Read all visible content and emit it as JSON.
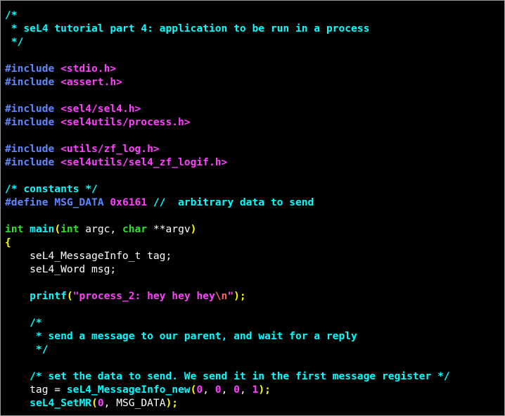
{
  "editor": {
    "lines": [
      [
        {
          "t": "/*",
          "c": "cm"
        }
      ],
      [
        {
          "t": " * seL4 tutorial part 4: application to be run in a process",
          "c": "cm"
        }
      ],
      [
        {
          "t": " */",
          "c": "cm"
        }
      ],
      [],
      [
        {
          "t": "#include ",
          "c": "pp"
        },
        {
          "t": "<stdio.h>",
          "c": "inc"
        }
      ],
      [
        {
          "t": "#include ",
          "c": "pp"
        },
        {
          "t": "<assert.h>",
          "c": "inc"
        }
      ],
      [],
      [
        {
          "t": "#include ",
          "c": "pp"
        },
        {
          "t": "<sel4/sel4.h>",
          "c": "inc"
        }
      ],
      [
        {
          "t": "#include ",
          "c": "pp"
        },
        {
          "t": "<sel4utils/process.h>",
          "c": "inc"
        }
      ],
      [],
      [
        {
          "t": "#include ",
          "c": "pp"
        },
        {
          "t": "<utils/zf_log.h>",
          "c": "inc"
        }
      ],
      [
        {
          "t": "#include ",
          "c": "pp"
        },
        {
          "t": "<sel4utils/sel4_zf_logif.h>",
          "c": "inc"
        }
      ],
      [],
      [
        {
          "t": "/* constants */",
          "c": "cm"
        }
      ],
      [
        {
          "t": "#define MSG_DATA ",
          "c": "pp"
        },
        {
          "t": "0x6161",
          "c": "num"
        },
        {
          "t": " //  arbitrary data to send",
          "c": "cm"
        }
      ],
      [],
      [
        {
          "t": "int",
          "c": "ty"
        },
        {
          "t": " ",
          "c": "df"
        },
        {
          "t": "main",
          "c": "fn"
        },
        {
          "t": "(",
          "c": "kw"
        },
        {
          "t": "int",
          "c": "ty"
        },
        {
          "t": " argc, ",
          "c": "df"
        },
        {
          "t": "char",
          "c": "ty"
        },
        {
          "t": " **argv",
          "c": "df"
        },
        {
          "t": ")",
          "c": "kw"
        }
      ],
      [
        {
          "t": "{",
          "c": "kw"
        }
      ],
      [
        {
          "t": "    seL4_MessageInfo_t tag;",
          "c": "df"
        }
      ],
      [
        {
          "t": "    seL4_Word msg;",
          "c": "df"
        }
      ],
      [],
      [
        {
          "t": "    ",
          "c": "df"
        },
        {
          "t": "printf",
          "c": "fn"
        },
        {
          "t": "(",
          "c": "kw"
        },
        {
          "t": "\"process_2: hey hey hey",
          "c": "st"
        },
        {
          "t": "\\n",
          "c": "esc"
        },
        {
          "t": "\"",
          "c": "st"
        },
        {
          "t": ");",
          "c": "kw"
        }
      ],
      [],
      [
        {
          "t": "    /*",
          "c": "cm"
        }
      ],
      [
        {
          "t": "     * send a message to our parent, and wait for a reply",
          "c": "cm"
        }
      ],
      [
        {
          "t": "     */",
          "c": "cm"
        }
      ],
      [],
      [
        {
          "t": "    /* set the data to send. We send it in the first message register */",
          "c": "cm"
        }
      ],
      [
        {
          "t": "    tag = ",
          "c": "df"
        },
        {
          "t": "seL4_MessageInfo_new",
          "c": "fn"
        },
        {
          "t": "(",
          "c": "kw"
        },
        {
          "t": "0",
          "c": "num"
        },
        {
          "t": ", ",
          "c": "df"
        },
        {
          "t": "0",
          "c": "num"
        },
        {
          "t": ", ",
          "c": "df"
        },
        {
          "t": "0",
          "c": "num"
        },
        {
          "t": ", ",
          "c": "df"
        },
        {
          "t": "1",
          "c": "num"
        },
        {
          "t": ");",
          "c": "kw"
        }
      ],
      [
        {
          "t": "    ",
          "c": "df"
        },
        {
          "t": "seL4_SetMR",
          "c": "fn"
        },
        {
          "t": "(",
          "c": "kw"
        },
        {
          "t": "0",
          "c": "num"
        },
        {
          "t": ", MSG_DATA",
          "c": "df"
        },
        {
          "t": ");",
          "c": "kw"
        }
      ]
    ]
  }
}
